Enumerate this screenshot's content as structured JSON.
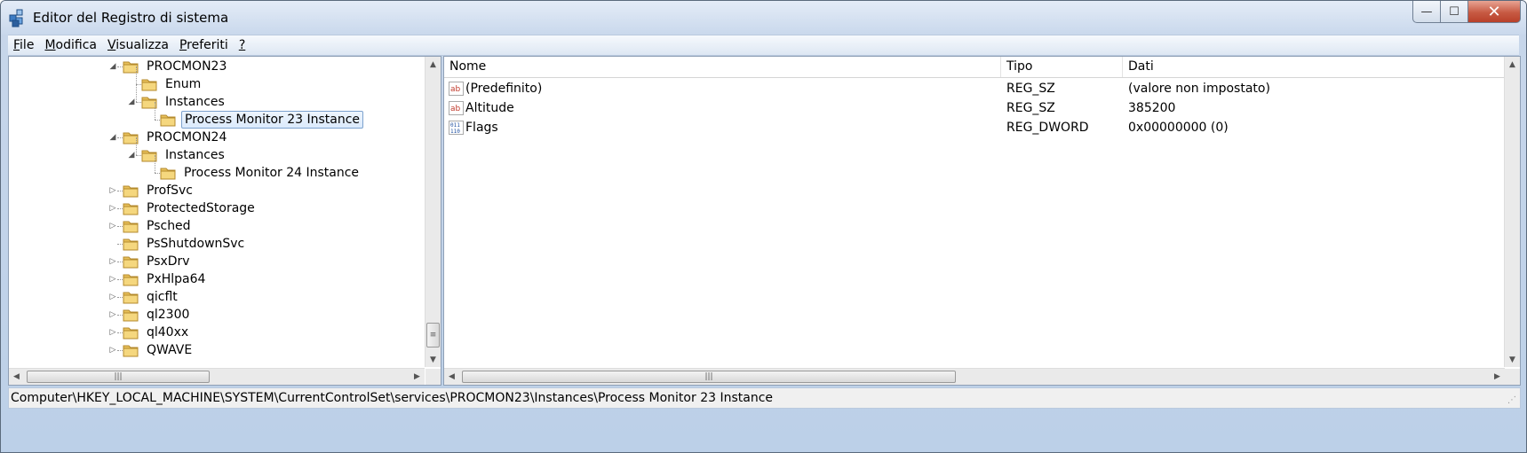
{
  "window": {
    "title": "Editor del Registro di sistema",
    "controls": {
      "minimize": "—",
      "maximize": "☐",
      "close": "✕"
    }
  },
  "menu": [
    {
      "label": "File",
      "accel": "F",
      "rest": "ile"
    },
    {
      "label": "Modifica",
      "accel": "M",
      "rest": "odifica"
    },
    {
      "label": "Visualizza",
      "accel": "V",
      "rest": "isualizza"
    },
    {
      "label": "Preferiti",
      "accel": "P",
      "rest": "referiti"
    },
    {
      "label": "?",
      "accel": "?",
      "rest": ""
    }
  ],
  "tree": {
    "nodes": [
      {
        "label": "PROCMON23",
        "expanded": true,
        "has_children": true
      },
      {
        "label": "Enum",
        "expanded": false,
        "has_children": false
      },
      {
        "label": "Instances",
        "expanded": true,
        "has_children": true
      },
      {
        "label": "Process Monitor 23 Instance",
        "expanded": false,
        "has_children": false,
        "selected": true
      },
      {
        "label": "PROCMON24",
        "expanded": true,
        "has_children": true
      },
      {
        "label": "Instances",
        "expanded": true,
        "has_children": true
      },
      {
        "label": "Process Monitor 24 Instance",
        "expanded": false,
        "has_children": false
      },
      {
        "label": "ProfSvc",
        "expanded": false,
        "has_children": true
      },
      {
        "label": "ProtectedStorage",
        "expanded": false,
        "has_children": true
      },
      {
        "label": "Psched",
        "expanded": false,
        "has_children": true
      },
      {
        "label": "PsShutdownSvc",
        "expanded": false,
        "has_children": false
      },
      {
        "label": "PsxDrv",
        "expanded": false,
        "has_children": true
      },
      {
        "label": "PxHlpa64",
        "expanded": false,
        "has_children": true
      },
      {
        "label": "qicflt",
        "expanded": false,
        "has_children": true
      },
      {
        "label": "ql2300",
        "expanded": false,
        "has_children": true
      },
      {
        "label": "ql40xx",
        "expanded": false,
        "has_children": true
      },
      {
        "label": "QWAVE",
        "expanded": false,
        "has_children": true
      }
    ]
  },
  "values": {
    "columns": [
      "Nome",
      "Tipo",
      "Dati"
    ],
    "rows": [
      {
        "name": "(Predefinito)",
        "type": "REG_SZ",
        "data": "(valore non impostato)",
        "icon": "string-value-icon"
      },
      {
        "name": "Altitude",
        "type": "REG_SZ",
        "data": "385200",
        "icon": "string-value-icon"
      },
      {
        "name": "Flags",
        "type": "REG_DWORD",
        "data": "0x00000000 (0)",
        "icon": "binary-value-icon"
      }
    ]
  },
  "status": {
    "path": "Computer\\HKEY_LOCAL_MACHINE\\SYSTEM\\CurrentControlSet\\services\\PROCMON23\\Instances\\Process Monitor 23 Instance"
  },
  "colors": {
    "title_gradient_top": "#e4ecf7",
    "close_button": "#c75a43",
    "folder": "#e8c05a",
    "selection_border": "#7da2ce"
  }
}
